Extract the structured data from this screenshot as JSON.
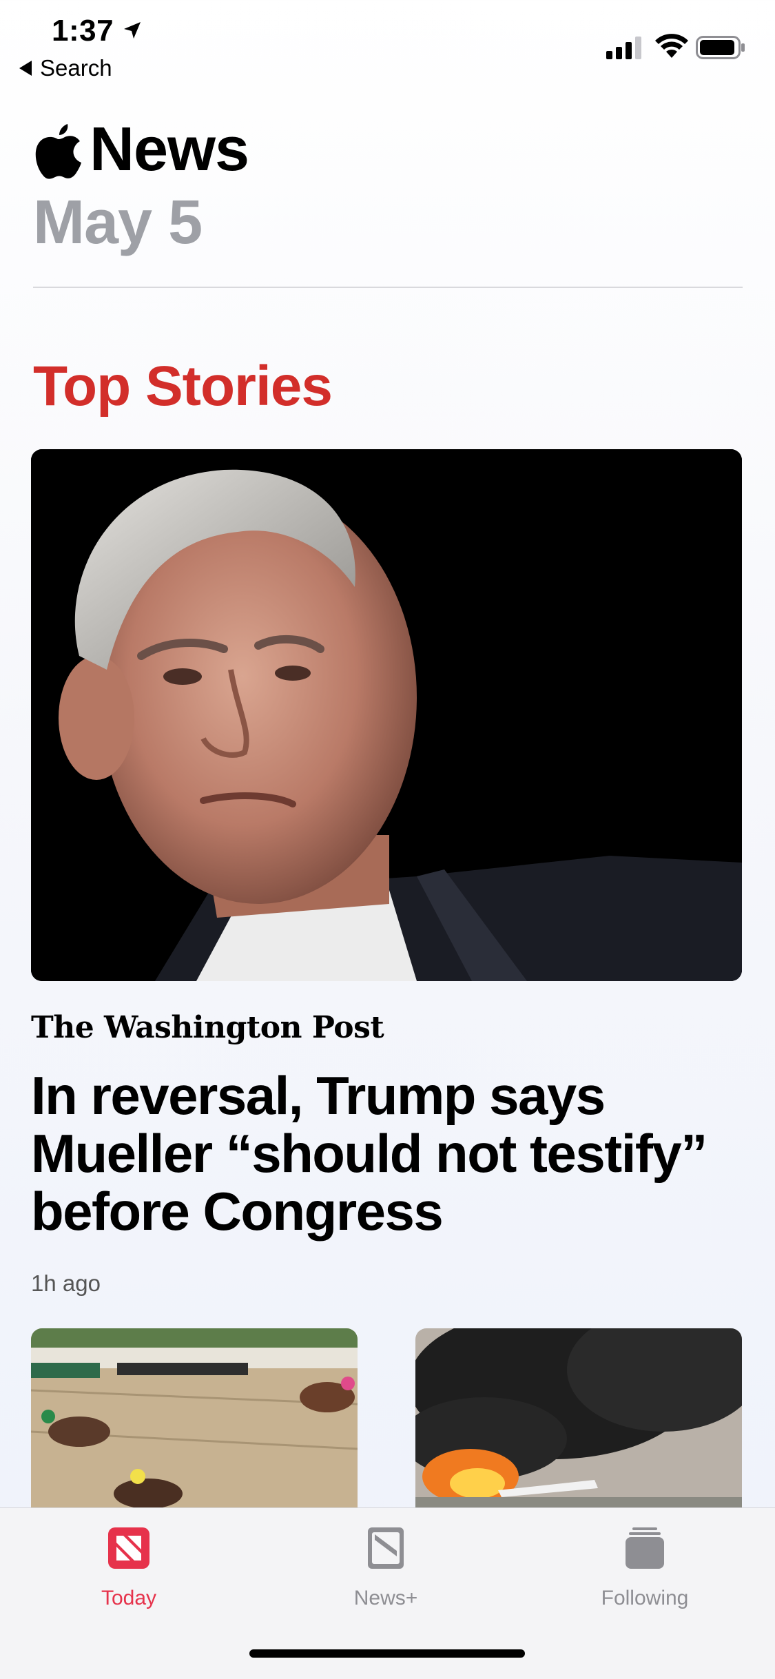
{
  "status": {
    "time": "1:37",
    "back_label": "Search"
  },
  "header": {
    "title": "News",
    "date": "May 5"
  },
  "section": {
    "title": "Top Stories"
  },
  "top_story": {
    "publisher": "The Washington Post",
    "headline": "In reversal, Trump says Mueller “should not testify” before Congress",
    "time_ago": "1h ago"
  },
  "tabs": [
    {
      "label": "Today",
      "icon": "news-today-icon",
      "active": true
    },
    {
      "label": "News+",
      "icon": "news-plus-icon",
      "active": false
    },
    {
      "label": "Following",
      "icon": "following-icon",
      "active": false
    }
  ],
  "colors": {
    "accent": "#d22e2a",
    "tab_active": "#e6324b",
    "tab_inactive": "#8e8e93",
    "date_gray": "#9ea0a6"
  }
}
